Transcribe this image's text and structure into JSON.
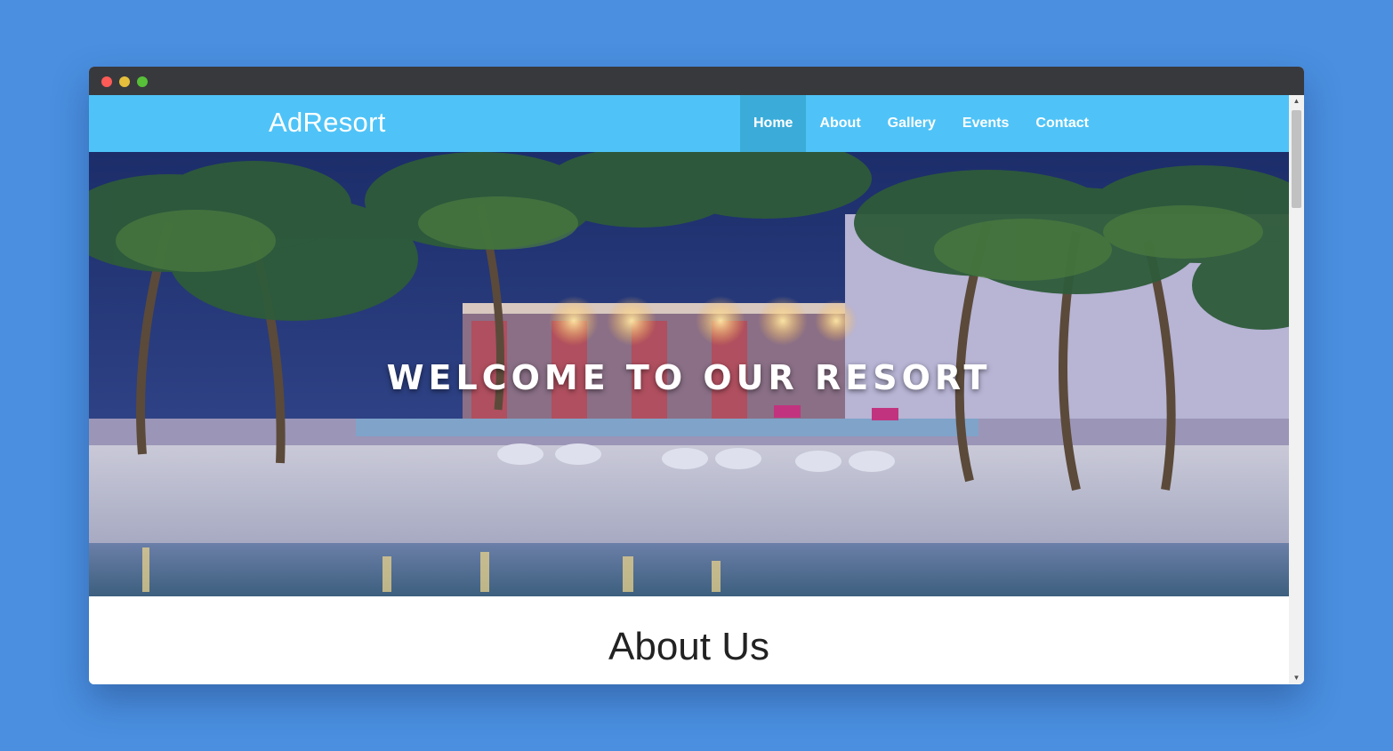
{
  "window": {
    "controls": [
      "close",
      "minimize",
      "maximize"
    ]
  },
  "navbar": {
    "brand": "AdResort",
    "items": [
      {
        "label": "Home",
        "active": true
      },
      {
        "label": "About",
        "active": false
      },
      {
        "label": "Gallery",
        "active": false
      },
      {
        "label": "Events",
        "active": false
      },
      {
        "label": "Contact",
        "active": false
      }
    ]
  },
  "hero": {
    "title": "WELCOME TO OUR RESORT",
    "image": "tropical-resort-beach-at-dusk"
  },
  "about": {
    "title": "About Us"
  },
  "colors": {
    "page_bg": "#4a8fe0",
    "nav_bg": "#4fc3f7",
    "nav_active": "#3bacd9",
    "titlebar": "#38393d"
  }
}
